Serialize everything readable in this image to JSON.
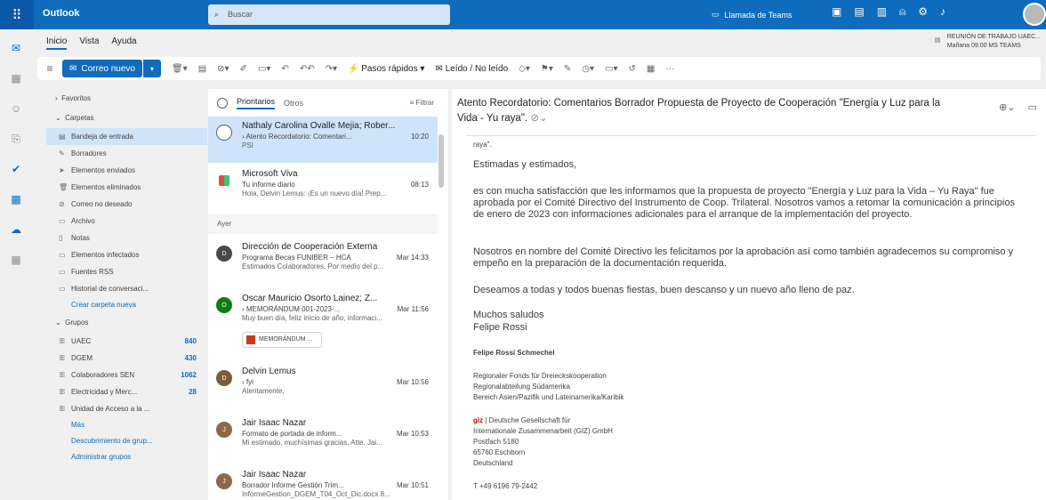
{
  "top": {
    "app_name": "Outlook",
    "search_placeholder": "Buscar",
    "teams_call": "Llamada de Teams"
  },
  "ribbon": {
    "tabs": [
      "Inicio",
      "Vista",
      "Ayuda"
    ],
    "new_mail": "Correo nuevo",
    "quick_steps": "Pasos rápidos",
    "read_unread": "Leído / No leído",
    "meeting_title": "REUNIÓN DE TRABAJO UAEC...",
    "meeting_time": "Mañana 09:00 MS TEAMS"
  },
  "folders": {
    "favorites": "Favoritos",
    "folders_head": "Carpetas",
    "items": [
      "Bandeja de entrada",
      "Borradores",
      "Elementos enviados",
      "Elementos eliminados",
      "Correo no deseado",
      "Archivo",
      "Notas",
      "Elementos infectados",
      "Fuentes RSS",
      "Historial de conversaci..."
    ],
    "create_folder": "Crear carpeta nueva",
    "groups_head": "Grupos",
    "groups": [
      {
        "name": "UAEC",
        "count": "840"
      },
      {
        "name": "DGEM",
        "count": "430"
      },
      {
        "name": "Colaboradores SEN",
        "count": "1062"
      },
      {
        "name": "Electricidad y Merc...",
        "count": "28"
      },
      {
        "name": "Unidad de Acceso a la ...",
        "count": ""
      }
    ],
    "more": "Más",
    "discover_groups": "Descubrimiento de grup...",
    "manage_groups": "Administrar grupos"
  },
  "list": {
    "tab_focused": "Prioritarios",
    "tab_other": "Otros",
    "filter": "Filtrar",
    "day_yesterday": "Ayer",
    "messages": [
      {
        "from": "Nathaly Carolina Ovalle Mejia; Rober...",
        "subject": "› Atento Recordatorio: Comentari...",
        "time": "10:20",
        "preview": "PSI"
      },
      {
        "from": "Microsoft Viva",
        "subject": "Tu informe diario",
        "time": "08:13",
        "preview": "Hola, Delvin Lemus: ¡Es un nuevo día! Prep..."
      },
      {
        "from": "Dirección de Cooperación Externa",
        "subject": "Programa Becas FUNIBER – HCA",
        "time": "Mar 14:33",
        "preview": "Estimados Colaboradores, Por medio del p..."
      },
      {
        "from": "Oscar Mauricio Osorto Lainez; Z...",
        "subject": "› MEMORÁNDUM 001-2023-...",
        "time": "Mar 11:56",
        "preview": "Muy buen día, feliz inicio de año, informaci..."
      },
      {
        "from": "Delvin Lemus",
        "subject": "› fyi",
        "time": "Mar 10:56",
        "preview": "Atentamente,"
      },
      {
        "from": "Jair Isaac Nazar",
        "subject": "Formato de portada de inform...",
        "time": "Mar 10:53",
        "preview": "Mi estimado, muchísimas gracias. Atte. Jai..."
      },
      {
        "from": "Jair Isaac Nazar",
        "subject": "Borrador Informe Gestión Trim...",
        "time": "Mar 10:51",
        "preview": "InformeGestion_DGEM_T04_Oct_Dic.docx 8..."
      }
    ],
    "attachment": "MEMORÁNDUM ..."
  },
  "reading": {
    "title": "Atento Recordatorio: Comentarios Borrador Propuesta de Proyecto de Cooperación \"Energía y Luz para la Vida - Yu raya\".",
    "prior": "raya\".",
    "greeting": "Estimadas y estimados,",
    "p1": "es con mucha satisfacción que les informamos que la propuesta de proyecto \"Energía y Luz para la Vida – Yu Raya\" fue aprobada por el Comité Directivo del Instrumento de Coop. Trilateral. Nosotros vamos a retomar la comunicación a principios de enero de 2023 con informaciones adicionales para el arranque de la implementación del proyecto.",
    "p2": "Nosotros en nombre del Comité Directivo les felicitamos por la aprobación así como también agradecemos su compromiso y empeño en la preparación de la documentación requerida.",
    "p3": "Deseamos a todas y todos buenas fiestas, buen descanso y un nuevo año lleno de paz.",
    "closing1": "Muchos saludos",
    "closing2": "Felipe Rossi",
    "sig_name": "Felipe Rossi Schmechel",
    "sig1": "Regionaler Fonds für Dreieckskooperation",
    "sig2": "Regionalabteilung Südamerika",
    "sig3": "Bereich Asien/Pazifik und Lateinamerika/Karibik",
    "giz": "giz",
    "org1": " | Deutsche Gesellschaft für",
    "org2": "Internationale Zusammenarbeit (GIZ) GmbH",
    "org3": "Postfach 5180",
    "org4": "65760 Eschborn",
    "org5": "Deutschland",
    "phone": "T +49 6196 79-2442"
  }
}
